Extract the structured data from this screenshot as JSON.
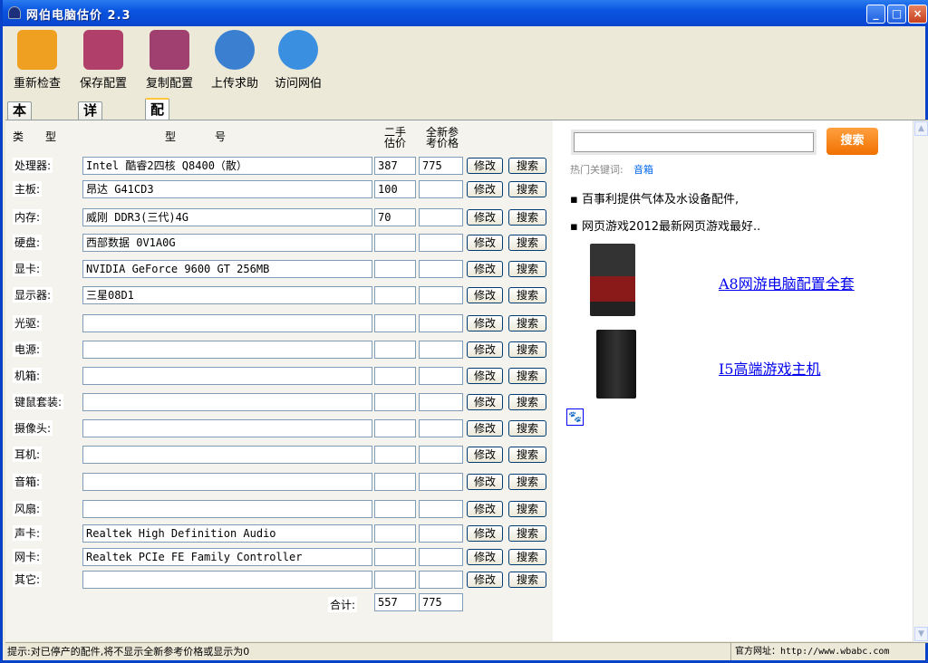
{
  "window": {
    "title": "网伯电脑估价 2.3",
    "minimize": "_",
    "maximize": "□",
    "close": "×"
  },
  "toolbar": [
    {
      "label": "重新检查",
      "icon": "gear-icon",
      "color": "#f0a020"
    },
    {
      "label": "保存配置",
      "icon": "floppy-disk-icon",
      "color": "#b0406a"
    },
    {
      "label": "复制配置",
      "icon": "copy-documents-icon",
      "color": "#a04070"
    },
    {
      "label": "上传求助",
      "icon": "user-add-icon",
      "color": "#3a7fd0"
    },
    {
      "label": "访问网伯",
      "icon": "globe-chat-icon",
      "color": "#3a8fe0"
    }
  ],
  "tabs": [
    "本机概况",
    "详细参数",
    "配置估价"
  ],
  "active_tab": 2,
  "table": {
    "headers": {
      "type": "类　　型",
      "model_left": "型",
      "model_right": "号",
      "used": "二手\n估价",
      "new": "全新参\n考价格"
    },
    "edit_label": "修改",
    "search_label": "搜索",
    "rows": [
      {
        "label": "处理器:",
        "model": "Intel 酷睿2四核 Q8400（散）",
        "used": "387",
        "new": "775"
      },
      {
        "label": "主板:",
        "model": "昂达 G41CD3",
        "used": "100",
        "new": ""
      },
      {
        "label": "内存:",
        "model": "威刚 DDR3(三代)4G",
        "used": "70",
        "new": ""
      },
      {
        "label": "硬盘:",
        "model": "西部数据 0V1A0G",
        "used": "",
        "new": ""
      },
      {
        "label": "显卡:",
        "model": "NVIDIA GeForce 9600 GT 256MB",
        "used": "",
        "new": ""
      },
      {
        "label": "显示器:",
        "model": "三星08D1",
        "used": "",
        "new": ""
      },
      {
        "label": "光驱:",
        "model": "",
        "used": "",
        "new": ""
      },
      {
        "label": "电源:",
        "model": "",
        "used": "",
        "new": ""
      },
      {
        "label": "机箱:",
        "model": "",
        "used": "",
        "new": ""
      },
      {
        "label": "键鼠套装:",
        "model": "",
        "used": "",
        "new": ""
      },
      {
        "label": "摄像头:",
        "model": "",
        "used": "",
        "new": ""
      },
      {
        "label": "耳机:",
        "model": "",
        "used": "",
        "new": ""
      },
      {
        "label": "音箱:",
        "model": "",
        "used": "",
        "new": ""
      },
      {
        "label": "风扇:",
        "model": "",
        "used": "",
        "new": ""
      },
      {
        "label": "声卡:",
        "model": "Realtek High Definition Audio",
        "used": "",
        "new": ""
      },
      {
        "label": "网卡:",
        "model": "Realtek PCIe FE Family Controller",
        "used": "",
        "new": ""
      },
      {
        "label": "其它:",
        "model": "",
        "used": "",
        "new": ""
      }
    ],
    "total_label": "合计:",
    "total_used": "557",
    "total_new": "775"
  },
  "ad": {
    "search_value": "",
    "search_button": "搜索",
    "hot_label": "热门关键词:",
    "hot_keyword": "音箱",
    "news": [
      "百事利提供气体及水设备配件,",
      "网页游戏2012最新网页游戏最好.."
    ],
    "products": [
      "A8网游电脑配置全套",
      "I5高端游戏主机"
    ]
  },
  "status": {
    "hint": "提示:对已停产的配件,将不显示全新参考价格或显示为0",
    "site": "官方网址：http://www.wbabc.com"
  }
}
